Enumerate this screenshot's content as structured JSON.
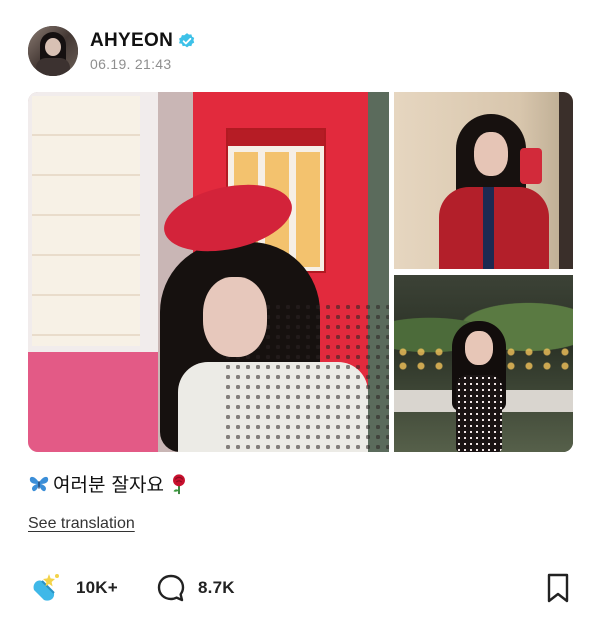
{
  "post": {
    "author": {
      "name": "AHYEON",
      "verified": true,
      "timestamp": "06.19. 21:43"
    },
    "photos": [
      {
        "description_key": "main-photo"
      },
      {
        "description_key": "mirror-selfie-photo"
      },
      {
        "description_key": "night-street-photo"
      }
    ],
    "caption": {
      "leading_emoji": "butterfly-icon",
      "text": "여러분 잘자요",
      "trailing_emoji": "rose-icon"
    },
    "translation_link": "See translation",
    "actions": {
      "like_count": "10K+",
      "comment_count": "8.7K"
    }
  },
  "colors": {
    "verified_badge": "#3dc1e8",
    "text_primary": "#111111",
    "timestamp": "#8f8f8f",
    "like_icon_blue": "#3fb8e8",
    "like_icon_yellow": "#f3d34a"
  }
}
